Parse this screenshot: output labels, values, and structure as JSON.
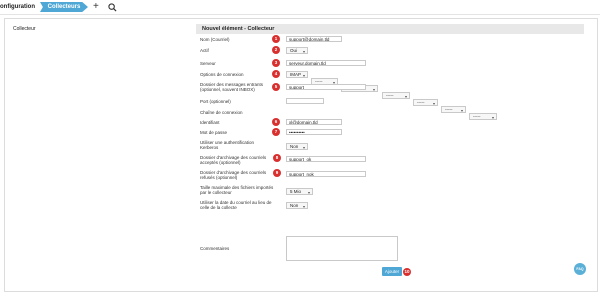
{
  "topbar": {
    "crumb_config": "onfiguration",
    "crumb_current": "Collecteurs"
  },
  "page_title": "Collecteur",
  "form": {
    "header": "Nouvel élément - Collecteur",
    "nom_label": "Nom (Courriel)",
    "nom_value": "support@domain.tld",
    "actif_label": "Actif",
    "actif_value": "Oui",
    "serveur_label": "Serveur",
    "serveur_value": "serveur.domain.tld",
    "options_label": "Options de connexion",
    "options_values": [
      "IMAP",
      "-----",
      "-----",
      "-----",
      "-----",
      "-----",
      "-----"
    ],
    "dossier_label": "Dossier des messages entrants (optionnel, souvent INBOX)",
    "dossier_value": "support",
    "port_label": "Port (optionnel)",
    "port_value": "",
    "chaine_label": "Chaîne de connexion",
    "ident_label": "Identifiant",
    "ident_value": "xl@domain.tld",
    "mdp_label": "Mot de passe",
    "mdp_value": "••••••••••",
    "kerberos_label": "Utiliser une authentification Kerberos",
    "kerberos_value": "Non",
    "archive_ok_label": "Dossier d'archivage des courriels acceptés (optionnel)",
    "archive_ok_value": "support_ok",
    "archive_ko_label": "Dossier d'archivage des courriels refusés (optionnel)",
    "archive_ko_value": "support_nok",
    "taille_label": "Taille maximale des fichiers importés par le collecteur",
    "taille_value": "5 Mio",
    "date_label": "Utiliser la date du courriel au lieu de celle de la collecte",
    "date_value": "Non",
    "comments_label": "Commentaires",
    "submit_label": "Ajouter"
  },
  "badges": [
    "1",
    "2",
    "3",
    "4",
    "5",
    "6",
    "7",
    "8",
    "9",
    "10"
  ],
  "help_label": "FAQ",
  "colors": {
    "accent": "#4fa7d6",
    "badge": "#d9302f"
  }
}
